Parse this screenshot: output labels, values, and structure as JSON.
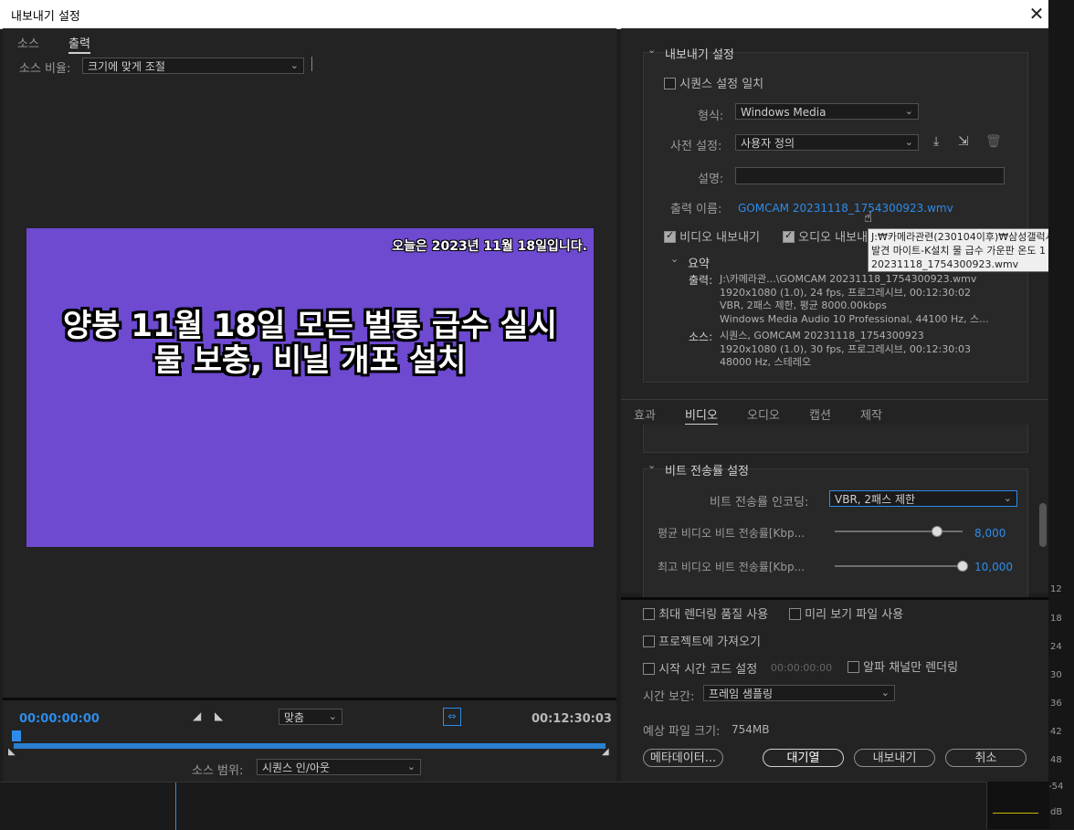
{
  "window": {
    "title": "내보내기 설정",
    "close": "✕"
  },
  "left": {
    "tabs": [
      "소스",
      "출력"
    ],
    "source_ratio_label": "소스 비율:",
    "source_ratio_value": "크기에 맞게 조절",
    "preview": {
      "date_text": "오늘은 2023년 11월 18일입니다.",
      "headline_1": "양봉  11월 18일 모든 벌통 급수 실시",
      "headline_2": "물 보충, 비닐 개포 설치",
      "background": "#6d4ad0"
    },
    "timeline": {
      "start": "00:00:00:00",
      "end": "00:12:30:03",
      "fit": "맞춤",
      "source_range_label": "소스 범위:",
      "source_range_value": "시퀀스 인/아웃"
    }
  },
  "right": {
    "export_header": "내보내기 설정",
    "match_sequence": "시퀀스 설정 일치",
    "format_label": "형식:",
    "format_value": "Windows Media",
    "preset_label": "사전 설정:",
    "preset_value": "사용자 정의",
    "comment_label": "설명:",
    "output_name_label": "출력 이름:",
    "output_name_value": "GOMCAM 20231118_1754300923.wmv",
    "export_video": "비디오 내보내기",
    "export_audio": "오디오 내보내기",
    "summary_header": "요약",
    "output_label": "출력:",
    "output_lines": [
      "J:\\카메라관...\\GOMCAM 20231118_1754300923.wmv",
      "1920x1080 (1.0), 24 fps, 프로그레시브, 00:12:30:02",
      "VBR, 2패스 제한, 평균 8000.00kbps",
      "Windows Media Audio 10 Professional, 44100 Hz, 스..."
    ],
    "source_label": "소스:",
    "source_lines": [
      "시퀀스, GOMCAM 20231118_1754300923",
      "1920x1080 (1.0), 30 fps, 프로그레시브, 00:12:30:03",
      "48000 Hz, 스테레오"
    ],
    "tabs": [
      "효과",
      "비디오",
      "오디오",
      "캡션",
      "제작"
    ],
    "bitrate_header": "비트 전송률 설정",
    "bitrate_encoding_label": "비트 전송률 인코딩:",
    "bitrate_encoding_value": "VBR, 2패스 제한",
    "avg_label": "평균 비디오 비트 전송률[Kbp...",
    "avg_value": "8,000",
    "max_label": "최고 비디오 비트 전송률[Kbp...",
    "max_value": "10,000"
  },
  "tooltip": [
    "J:₩카메라관련(230104이후)₩삼성갤럭시",
    "발견 마이트-K설치 물 급수 가운판 온도 1",
    "20231118_1754300923.wmv"
  ],
  "bottom": {
    "max_render": "최대 렌더링 품질 사용",
    "preview_files": "미리 보기 파일 사용",
    "import_project": "프로젝트에 가져오기",
    "start_timecode": "시작 시간 코드 설정",
    "start_timecode_value": "00:00:00:00",
    "alpha_only": "알파 채널만 렌더링",
    "time_interp_label": "시간 보간:",
    "time_interp_value": "프레임 샘플링",
    "file_size_label": "예상 파일 크기:",
    "file_size_value": "754MB",
    "metadata_btn": "메타데이터...",
    "queue_btn": "대기열",
    "export_btn": "내보내기",
    "cancel_btn": "취소"
  },
  "meter": {
    "labels": [
      "12",
      "18",
      "24",
      "30",
      "36",
      "42",
      "48",
      "-54",
      "dB"
    ]
  }
}
